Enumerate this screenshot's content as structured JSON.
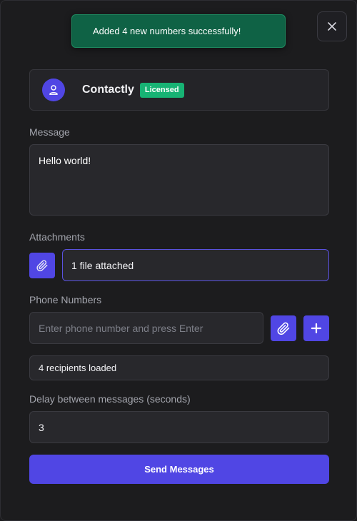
{
  "toast": {
    "message": "Added 4 new numbers successfully!"
  },
  "close_icon": "close-icon",
  "license": {
    "app_name": "Contactly",
    "badge": "Licensed",
    "avatar_icon": "user-icon"
  },
  "message": {
    "label": "Message",
    "value": "Hello world!"
  },
  "attachments": {
    "label": "Attachments",
    "status": "1 file attached",
    "icon": "paperclip-icon"
  },
  "phone": {
    "label": "Phone Numbers",
    "placeholder": "Enter phone number and press Enter",
    "import_icon": "paperclip-icon",
    "add_icon": "plus-icon",
    "recipients": "4 recipients loaded"
  },
  "delay": {
    "label": "Delay between messages (seconds)",
    "value": "3"
  },
  "send_button": "Send Messages",
  "colors": {
    "accent": "#5046e4",
    "success": "#17b374",
    "toast_bg": "#0f6245",
    "background": "#1c1c1e"
  }
}
